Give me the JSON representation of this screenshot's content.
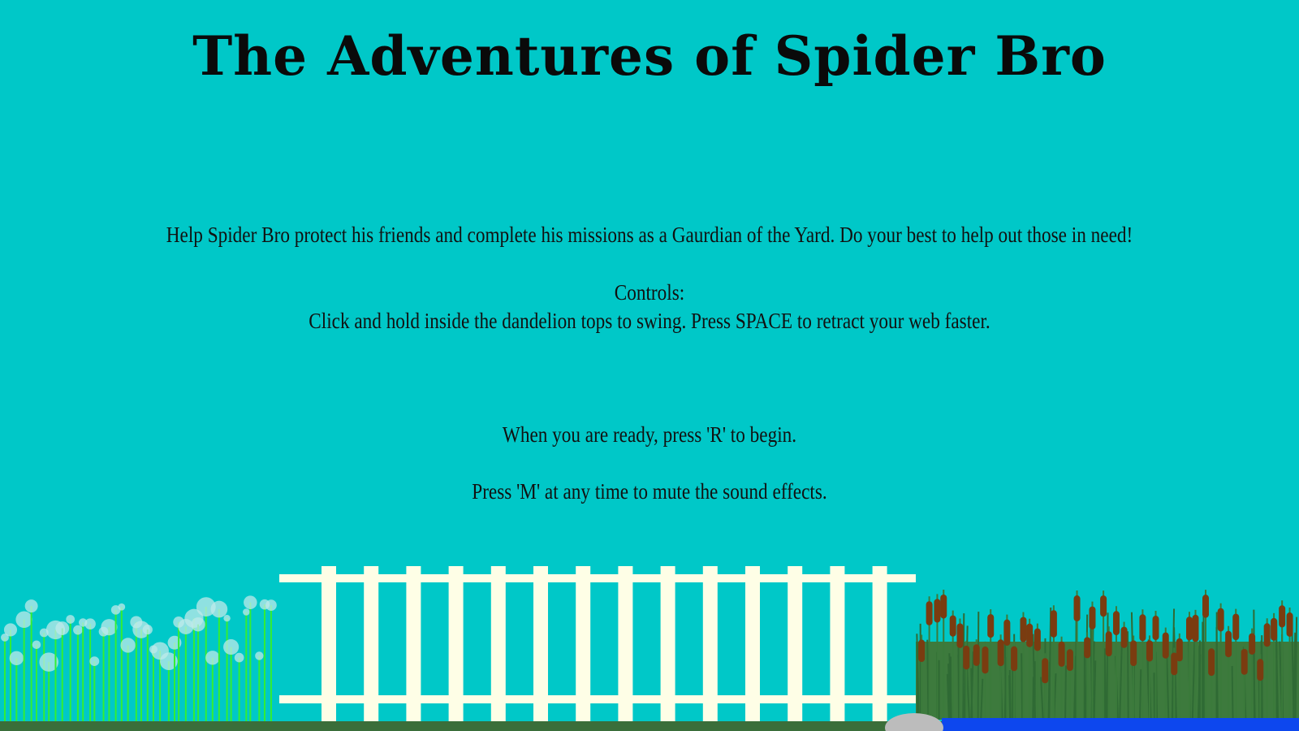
{
  "game": {
    "title": "The Adventures of Spider Bro",
    "intro": "Help Spider Bro protect his friends and complete his missions as a Gaurdian of the Yard. Do your best to help out those in need!",
    "controls_heading": "Controls:",
    "controls_text": "Click and hold inside the dandelion tops to swing. Press SPACE to retract your web faster.",
    "start_prompt": "When you are ready, press 'R' to begin.",
    "mute_prompt": "Press 'M' at any time to mute the sound effects."
  },
  "colors": {
    "sky": "#00c8c8",
    "fence": "#fefee6",
    "grass": "#3a6e3a",
    "stem": "#33ee33",
    "seed_puff": "#bfe9e9",
    "cattail_head": "#7a3c10",
    "reed": "#3d7a3d",
    "water": "#0d47ee",
    "rock": "#bcbcbc"
  },
  "scene_icons": [
    "dandelion-icon",
    "picket-fence-icon",
    "cattail-icon",
    "pond-icon",
    "rock-icon"
  ]
}
